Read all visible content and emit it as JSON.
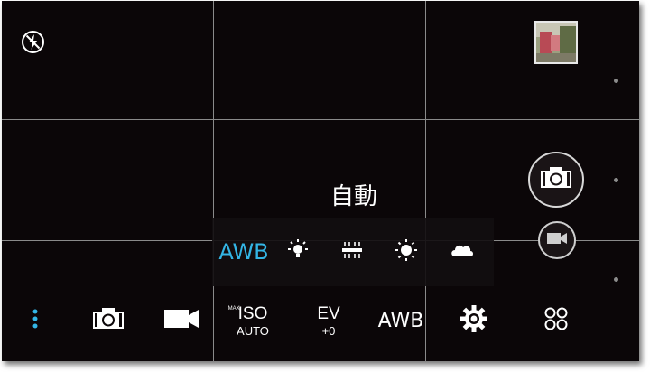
{
  "viewfinder": {
    "mode_label": "自動"
  },
  "flash": {
    "icon": "flash-off-icon"
  },
  "gallery": {
    "icon": "gallery-thumbnail"
  },
  "shutter": {
    "icon": "camera-icon"
  },
  "record": {
    "icon": "video-camera-icon"
  },
  "white_balance": {
    "options": [
      {
        "label": "AWB",
        "selected": true
      },
      {
        "icon": "incandescent-icon"
      },
      {
        "icon": "fluorescent-icon"
      },
      {
        "icon": "daylight-icon"
      },
      {
        "icon": "cloudy-icon"
      }
    ],
    "accent": "#33b5e5"
  },
  "bottom_bar": {
    "menu_icon": "more-vertical-icon",
    "camera_mode_icon": "camera-icon",
    "video_mode_icon": "video-camera-icon",
    "iso": {
      "max_label": "MAX",
      "label": "ISO",
      "value": "AUTO"
    },
    "ev": {
      "label": "EV",
      "value": "+0"
    },
    "wb": {
      "label": "AWB"
    },
    "settings_icon": "gear-icon",
    "modes_icon": "grid-circles-icon"
  }
}
